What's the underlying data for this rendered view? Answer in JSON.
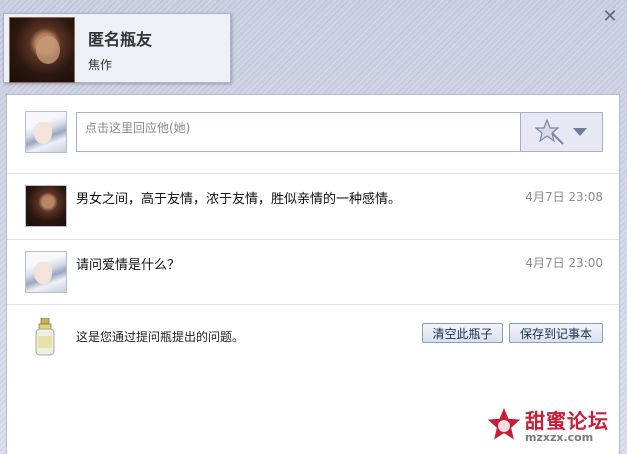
{
  "header": {
    "title": "匿名瓶友",
    "subtitle": "焦作"
  },
  "reply": {
    "placeholder": "点击这里回应他(她)"
  },
  "messages": [
    {
      "text": "男女之间，高于友情，浓于友情，胜似亲情的一种感情。",
      "time": "4月7日 23:08"
    },
    {
      "text": "请问爱情是什么？",
      "time": "4月7日 23:00"
    }
  ],
  "footer": {
    "note": "这是您通过提问瓶提出的问题。",
    "clear_label": "清空此瓶子",
    "save_label": "保存到记事本"
  },
  "watermark": {
    "brand": "甜蜜论坛",
    "url": "mzxzx.com"
  },
  "colors": {
    "accent": "#5a6a8c",
    "watermark_red": "#c4203a"
  }
}
